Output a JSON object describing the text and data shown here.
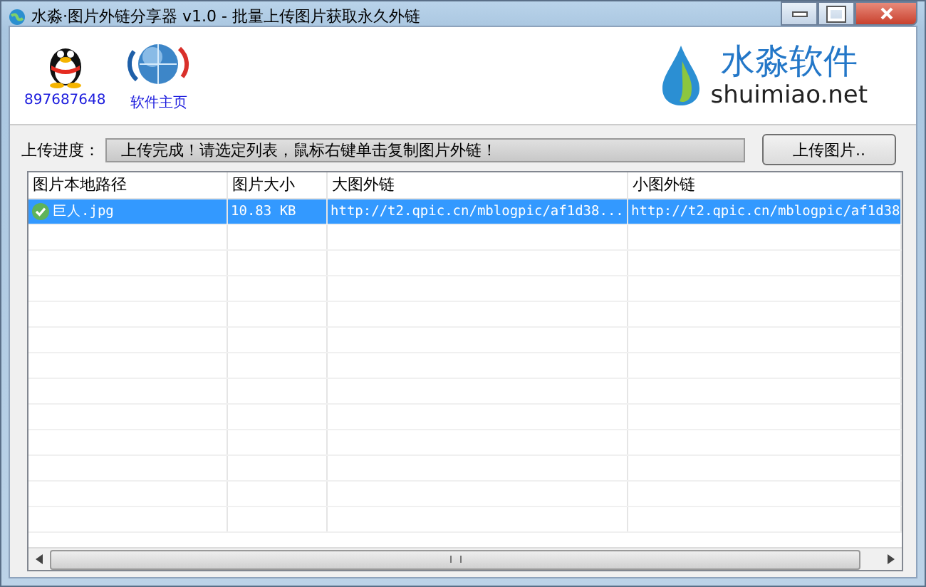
{
  "window": {
    "title": "水淼·图片外链分享器 v1.0 - 批量上传图片获取永久外链"
  },
  "header": {
    "links": [
      {
        "kind": "qq",
        "label": "897687648"
      },
      {
        "kind": "globe",
        "label": "软件主页"
      }
    ],
    "logo": {
      "name": "水淼软件",
      "domain": "shuimiao.net"
    }
  },
  "upload": {
    "label": "上传进度：",
    "progress": {
      "level": 1,
      "message": "上传完成！请选定列表，鼠标右键单击复制图片外链！"
    },
    "button": "上传图片.."
  },
  "table": {
    "columns": [
      "图片本地路径",
      "图片大小",
      "大图外链",
      "小图外链"
    ],
    "rows": [
      {
        "selected": true,
        "done": true,
        "cells": [
          "巨人.jpg",
          "10.83 KB",
          "http://t2.qpic.cn/mblogpic/af1d38...",
          "http://t2.qpic.cn/mblogpic/af1d38"
        ]
      }
    ]
  }
}
